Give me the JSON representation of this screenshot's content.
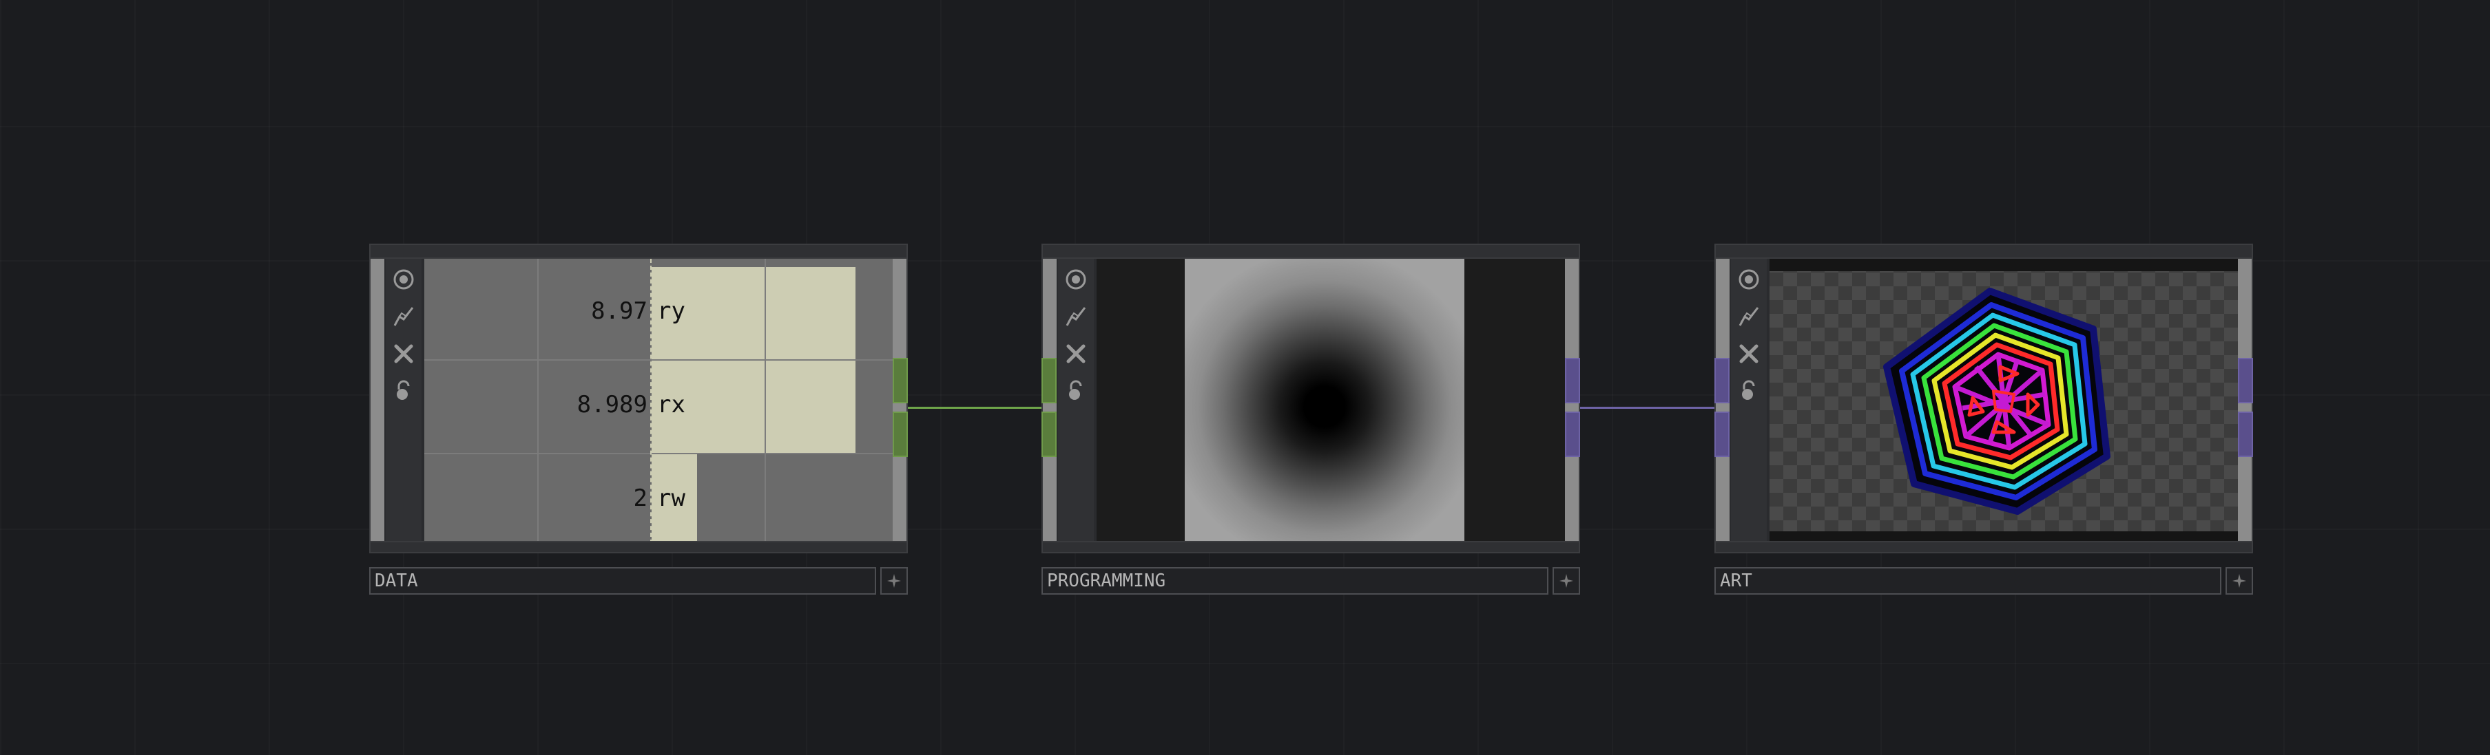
{
  "colors": {
    "background": "#1b1c1f",
    "chop_green": "#6fa54a",
    "top_purple": "#6e63a6",
    "table_cell": "#cdcdb3"
  },
  "node_icons": [
    "viewer-active-icon",
    "cook-flag-icon",
    "bypass-icon",
    "lock-icon"
  ],
  "nodes": [
    {
      "id": "data",
      "label": "DATA",
      "channels": [
        {
          "name": "ry",
          "value": "8.97"
        },
        {
          "name": "rx",
          "value": "8.989"
        },
        {
          "name": "rw",
          "value": "2"
        }
      ]
    },
    {
      "id": "programming",
      "label": "PROGRAMMING"
    },
    {
      "id": "art",
      "label": "ART"
    }
  ]
}
